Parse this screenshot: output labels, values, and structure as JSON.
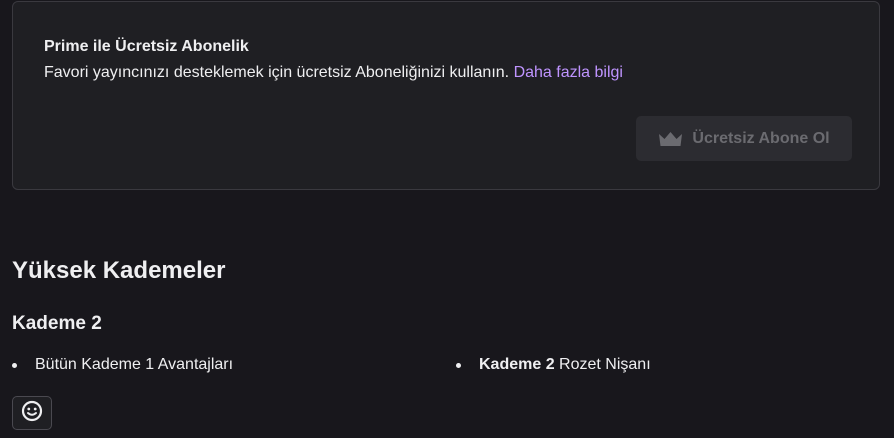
{
  "prime": {
    "title": "Prime ile Ücretsiz Abonelik",
    "description": "Favori yayıncınızı desteklemek için ücretsiz Aboneliğinizi kullanın.",
    "learn_more_link": "Daha fazla bilgi",
    "subscribe_button": "Ücretsiz Abone Ol",
    "button_icon": "crown-icon",
    "link_color": "#bf94ff",
    "button_disabled": true
  },
  "tiers": {
    "section_title": "Yüksek Kademeler",
    "tier_title": "Kademe 2",
    "benefits": [
      {
        "text": "Bütün Kademe 1 Avantajları"
      },
      {
        "bold": "Kademe 2",
        "text": "Rozet Nişanı"
      }
    ],
    "emote_icon": "smiley-icon"
  }
}
